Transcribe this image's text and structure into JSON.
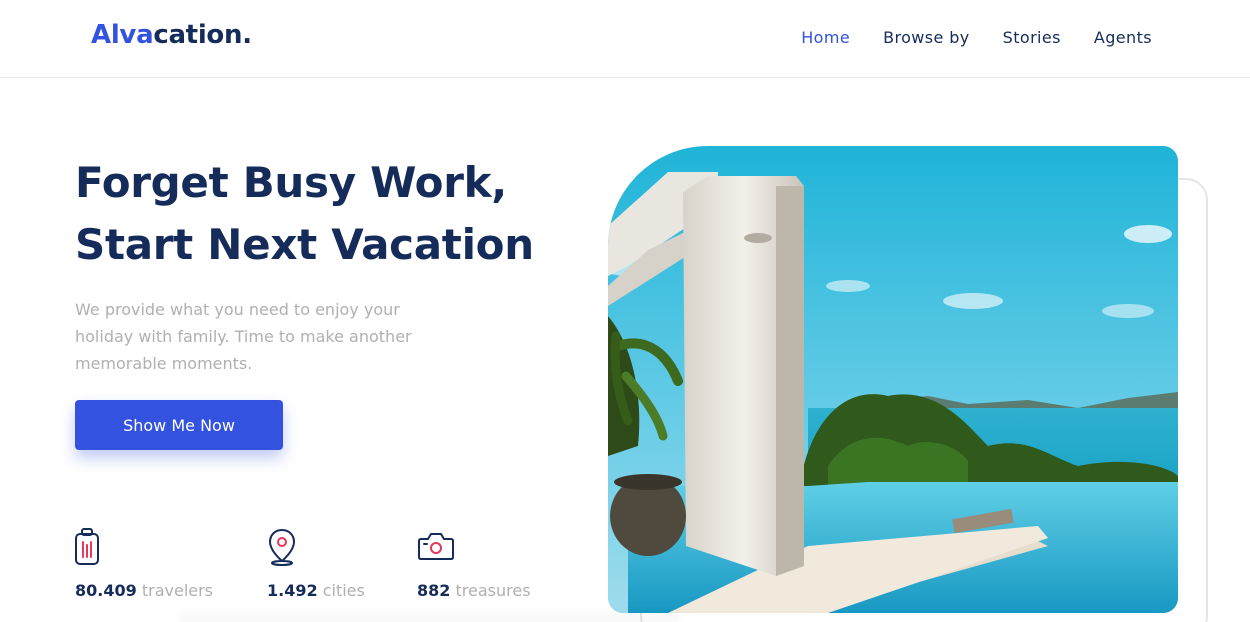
{
  "header": {
    "logo_accent": "Alva",
    "logo_rest": "cation."
  },
  "nav": {
    "items": [
      {
        "label": "Home",
        "active": true
      },
      {
        "label": "Browse by",
        "active": false
      },
      {
        "label": "Stories",
        "active": false
      },
      {
        "label": "Agents",
        "active": false
      }
    ]
  },
  "hero": {
    "title_line1": "Forget Busy Work,",
    "title_line2": "Start Next Vacation",
    "description": "We provide what you need to enjoy your holiday with family. Time to make another memorable moments.",
    "cta_label": "Show Me Now"
  },
  "stats": [
    {
      "icon": "suitcase-icon",
      "number": "80.409",
      "label": "travelers"
    },
    {
      "icon": "map-pin-icon",
      "number": "1.492",
      "label": "cities"
    },
    {
      "icon": "camera-icon",
      "number": "882",
      "label": "treasures"
    }
  ],
  "colors": {
    "primary": "#3252df",
    "navy": "#152c5b",
    "muted": "#b0b0b0",
    "accent_pink": "#e5385a"
  }
}
